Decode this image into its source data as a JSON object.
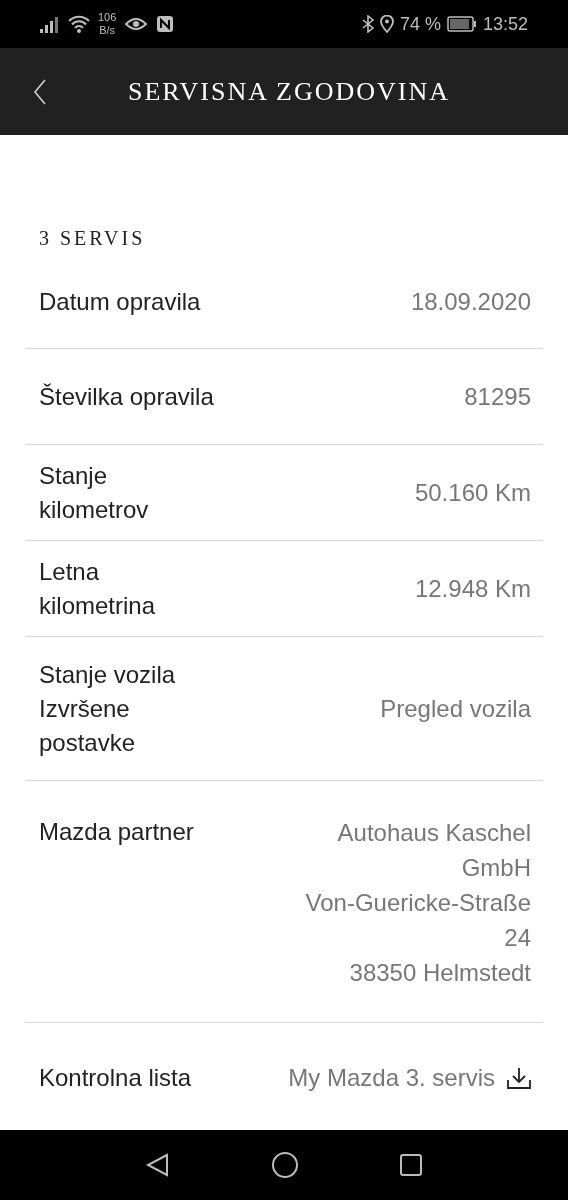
{
  "status_bar": {
    "network_speed": [
      "106",
      "B/s"
    ],
    "battery": "74 %",
    "time": "13:52"
  },
  "header": {
    "title": "SERVISNA ZGODOVINA"
  },
  "section": {
    "title": "3 SERVIS"
  },
  "rows": [
    {
      "label": [
        "Datum opravila"
      ],
      "value": [
        "18.09.2020"
      ],
      "kind": "text"
    },
    {
      "label": [
        "Številka opravila"
      ],
      "value": [
        "81295"
      ],
      "kind": "text"
    },
    {
      "label": [
        "Stanje",
        "kilometrov"
      ],
      "value": [
        "50.160 Km"
      ],
      "kind": "text"
    },
    {
      "label": [
        "Letna",
        "kilometrina"
      ],
      "value": [
        "12.948 Km"
      ],
      "kind": "text"
    },
    {
      "label": [
        "Stanje vozila",
        "Izvršene",
        "postavke"
      ],
      "value": [
        "Pregled vozila"
      ],
      "kind": "text"
    },
    {
      "label": [
        "Mazda partner"
      ],
      "value": [
        "Autohaus Kaschel",
        "GmbH",
        "Von-Guericke-Straße",
        "24",
        "38350 Helmstedt"
      ],
      "kind": "text"
    },
    {
      "label": [
        "Kontrolna lista"
      ],
      "value": [
        "My Mazda 3. servis"
      ],
      "kind": "download"
    }
  ]
}
